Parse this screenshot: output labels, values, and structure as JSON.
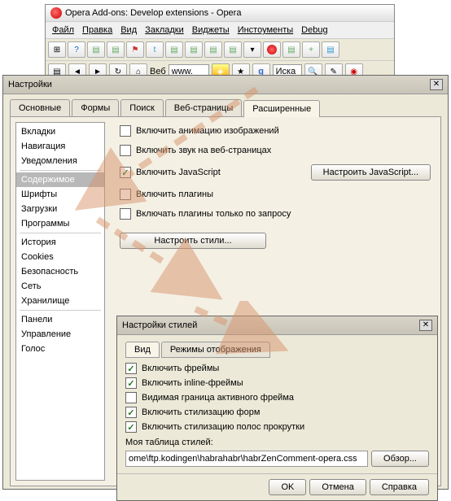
{
  "opera": {
    "title": "Opera Add-ons: Develop extensions - Opera",
    "menu": [
      "Файл",
      "Правка",
      "Вид",
      "Закладки",
      "Виджеты",
      "Инстоументы",
      "Debug"
    ],
    "addr": {
      "web": "Веб",
      "www": "www.",
      "search": "Иска"
    }
  },
  "settings": {
    "title": "Настройки",
    "tabs": [
      "Основные",
      "Формы",
      "Поиск",
      "Веб-страницы",
      "Расширенные"
    ],
    "active_tab": 4,
    "sidebar": {
      "groups": [
        [
          "Вкладки",
          "Навигация",
          "Уведомления"
        ],
        [
          "Содержимое",
          "Шрифты",
          "Загрузки",
          "Программы"
        ],
        [
          "История",
          "Cookies",
          "Безопасность",
          "Сеть",
          "Хранилище"
        ],
        [
          "Панели",
          "Управление",
          "Голос"
        ]
      ],
      "selected": "Содержимое"
    },
    "content": {
      "enable_img_anim": {
        "label": "Включить анимацию изображений",
        "checked": false
      },
      "enable_sound": {
        "label": "Включить звук на веб-страницах",
        "checked": false
      },
      "enable_js": {
        "label": "Включить JavaScript",
        "checked": true
      },
      "js_btn": "Настроить JavaScript...",
      "enable_plugins": {
        "label": "Включить плагины",
        "checked": false
      },
      "plugins_ondemand": {
        "label": "Включать плагины только по запросу",
        "checked": false
      },
      "styles_btn": "Настроить стили..."
    }
  },
  "styles": {
    "title": "Настройки стилей",
    "tabs": [
      "Вид",
      "Режимы отображения"
    ],
    "options": {
      "frames": {
        "label": "Включить фреймы",
        "checked": true
      },
      "inline_frames": {
        "label": "Включить inline-фреймы",
        "checked": true
      },
      "active_border": {
        "label": "Видимая граница активного фрейма",
        "checked": false
      },
      "style_forms": {
        "label": "Включить стилизацию форм",
        "checked": true
      },
      "style_scroll": {
        "label": "Включить стилизацию полос прокрутки",
        "checked": true
      }
    },
    "css_label": "Моя таблица стилей:",
    "css_path": "ome\\ftp.kodingen\\habrahabr\\habrZenComment-opera.css",
    "browse": "Обзор...",
    "ok": "OK",
    "cancel": "Отмена",
    "help": "Справка"
  }
}
